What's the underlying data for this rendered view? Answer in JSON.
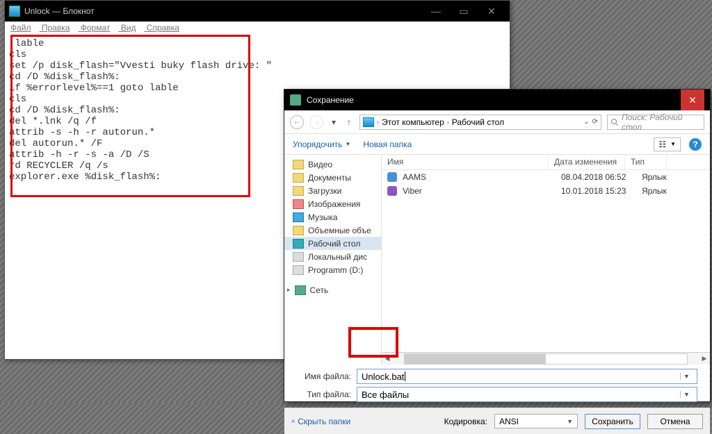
{
  "notepad": {
    "title": "Unlock — Блокнот",
    "menu": {
      "file": "Файл",
      "edit": "Правка",
      "format": "Формат",
      "view": "Вид",
      "help": "Справка"
    },
    "content": ":lable\ncls\nset /p disk_flash=\"Vvesti buky flash drive: \"\ncd /D %disk_flash%:\nif %errorlevel%==1 goto lable\ncls\ncd /D %disk_flash%:\ndel *.lnk /q /f\nattrib -s -h -r autorun.*\ndel autorun.* /F\nattrib -h -r -s -a /D /S\nrd RECYCLER /q /s\nexplorer.exe %disk_flash%:"
  },
  "save": {
    "title": "Сохранение",
    "path": {
      "computer": "Этот компьютер",
      "desktop": "Рабочий стол"
    },
    "search_placeholder": "Поиск: Рабочий стол",
    "toolbar": {
      "organize": "Упорядочить",
      "new_folder": "Новая папка"
    },
    "tree": {
      "video": "Видео",
      "documents": "Документы",
      "downloads": "Загрузки",
      "pictures": "Изображения",
      "music": "Музыка",
      "volumes": "Объемные объе",
      "desktop": "Рабочий стол",
      "localdisk": "Локальный дис",
      "programm": "Programm (D:)",
      "network": "Сеть"
    },
    "columns": {
      "name": "Имя",
      "date": "Дата изменения",
      "type": "Тип"
    },
    "files": [
      {
        "name": "AAMS",
        "date": "08.04.2018 06:52",
        "type": "Ярлык"
      },
      {
        "name": "Viber",
        "date": "10.01.2018 15:23",
        "type": "Ярлык"
      }
    ],
    "fields": {
      "filename_label": "Имя файла:",
      "filename_value": "Unlock.bat",
      "filetype_label": "Тип файла:",
      "filetype_value": "Все файлы"
    },
    "bottom": {
      "hide": "Скрыть папки",
      "encoding_label": "Кодировка:",
      "encoding_value": "ANSI",
      "save": "Сохранить",
      "cancel": "Отмена"
    }
  }
}
